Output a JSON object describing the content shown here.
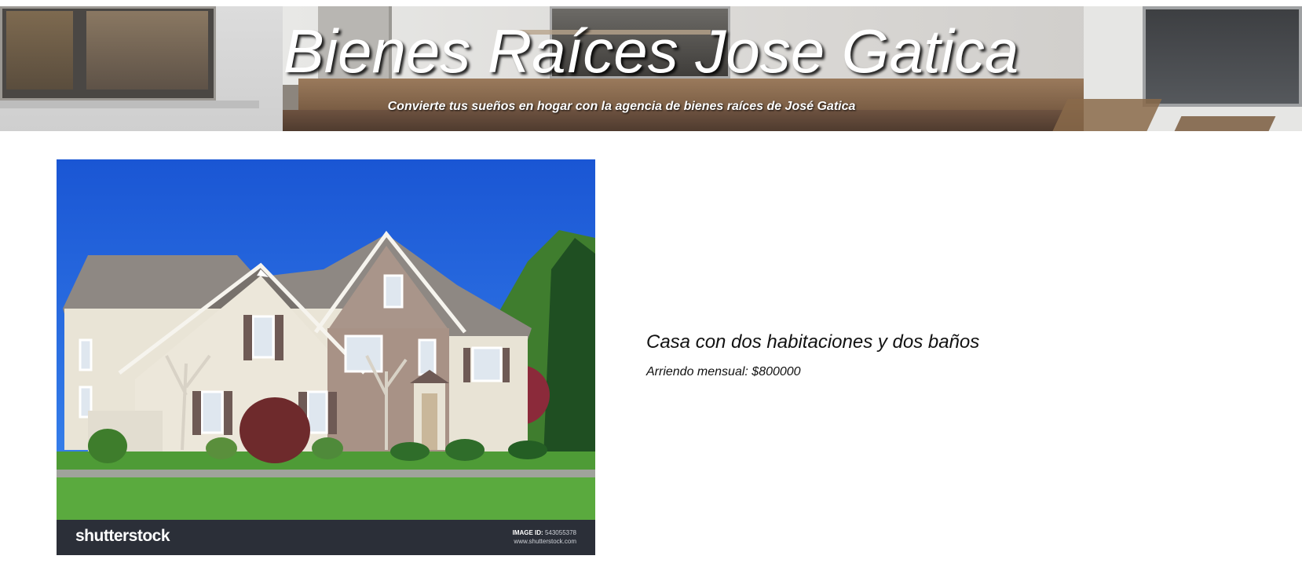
{
  "header": {
    "title": "Bienes Raíces Jose Gatica",
    "subtitle": "Convierte tus sueños en hogar con la agencia de bienes raíces de José Gatica"
  },
  "listing": {
    "title": "Casa con dos habitaciones y dos baños",
    "price_text": "Arriendo mensual: $800000",
    "photo": {
      "brand": "shutterstock",
      "image_id_label": "IMAGE ID:",
      "image_id": "543055378",
      "site": "www.shutterstock.com"
    }
  },
  "colors": {
    "sky": "#1e5fd6",
    "photo_footer": "#2b2f38",
    "text": "#111111"
  }
}
